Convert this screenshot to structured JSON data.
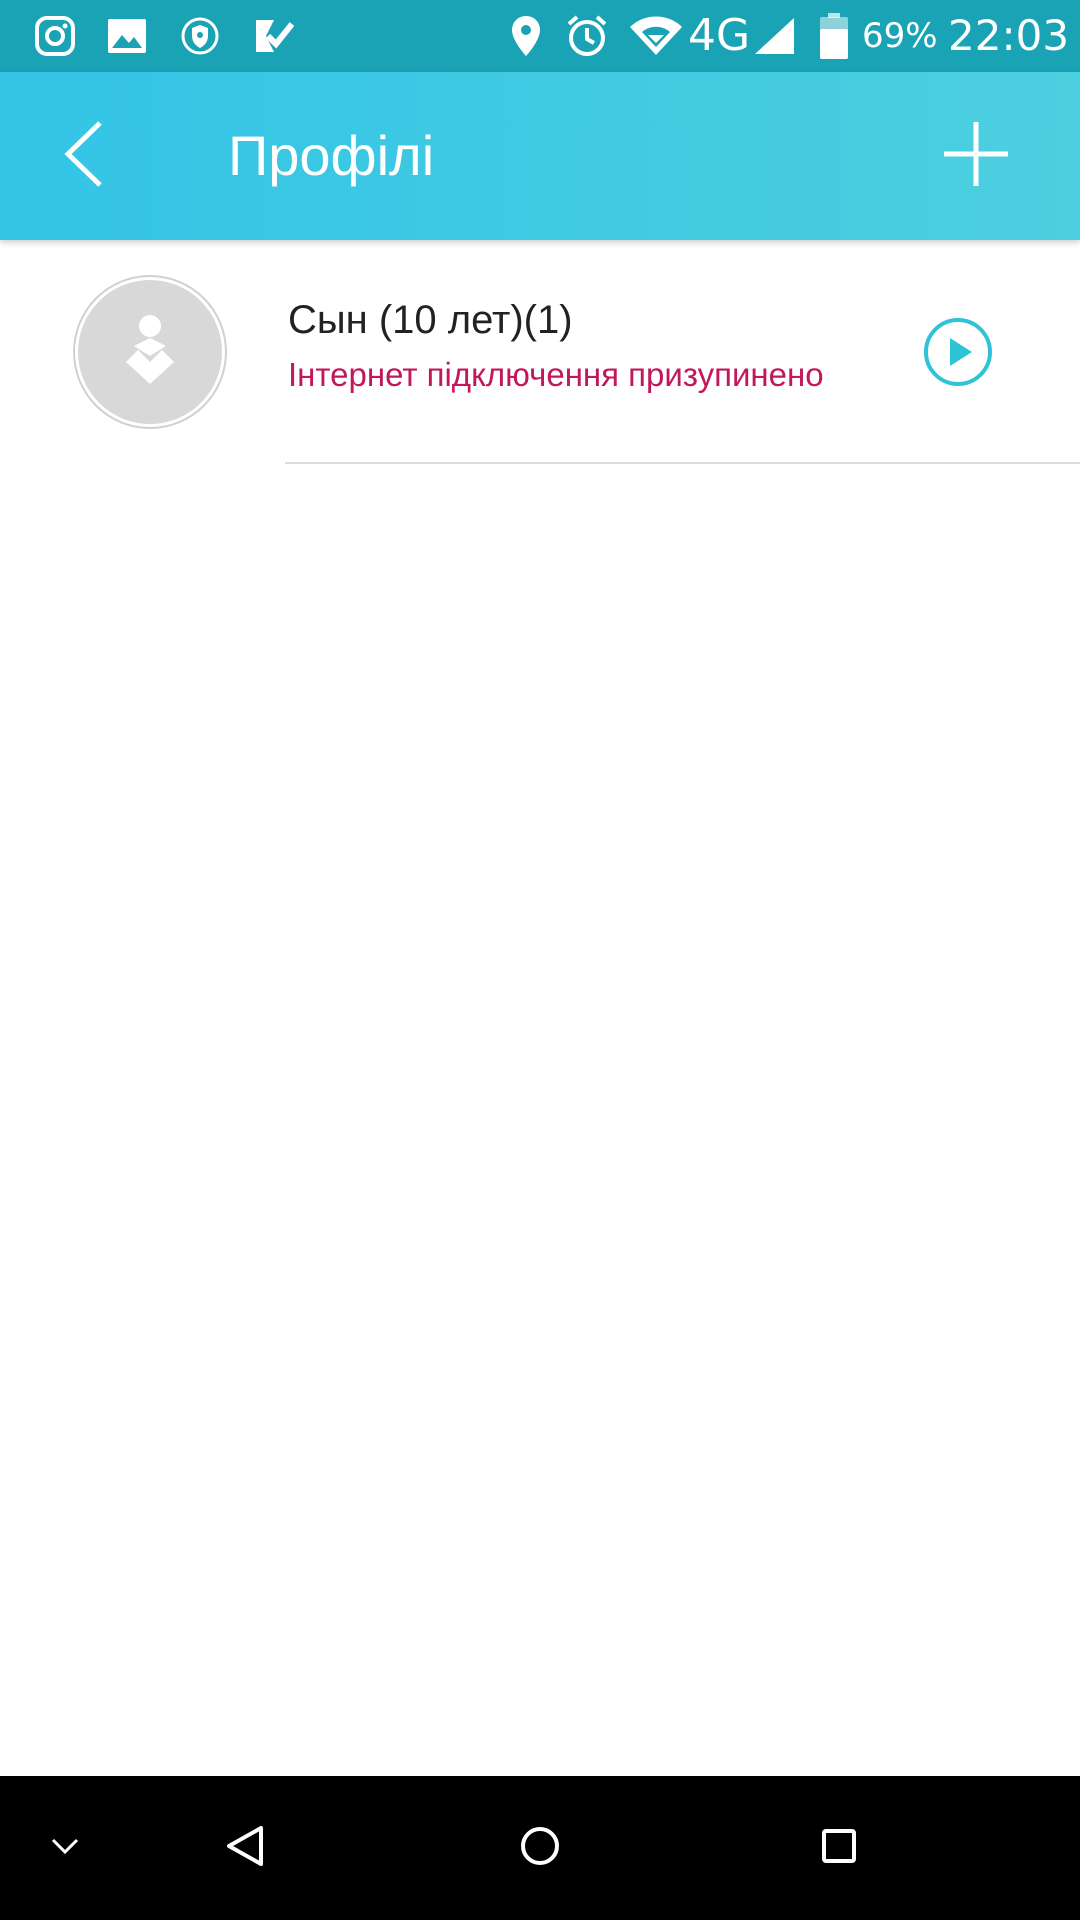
{
  "status_bar": {
    "battery_text": "69%",
    "time": "22:03",
    "network": "4G",
    "icons": [
      "instagram-icon",
      "gallery-icon",
      "vpn-shield-icon",
      "tasks-icon",
      "location-icon",
      "alarm-icon",
      "wifi-icon",
      "signal-icon",
      "battery-icon"
    ]
  },
  "app_bar": {
    "title": "Профілі",
    "back_icon": "chevron-left-icon",
    "add_icon": "plus-icon"
  },
  "profiles": [
    {
      "name": "Сын (10 лет)(1)",
      "status": "Інтернет підключення призупинено",
      "action_icon": "play-icon"
    }
  ],
  "nav_bar": {
    "icons": [
      "chevron-down-icon",
      "back-triangle-icon",
      "home-circle-icon",
      "recents-square-icon"
    ]
  },
  "colors": {
    "status_bar": "#1aa3b4",
    "app_bar_start": "#33c4e6",
    "app_bar_end": "#4ccfdf",
    "status_paused": "#c2185b",
    "accent": "#2ec4d6"
  }
}
